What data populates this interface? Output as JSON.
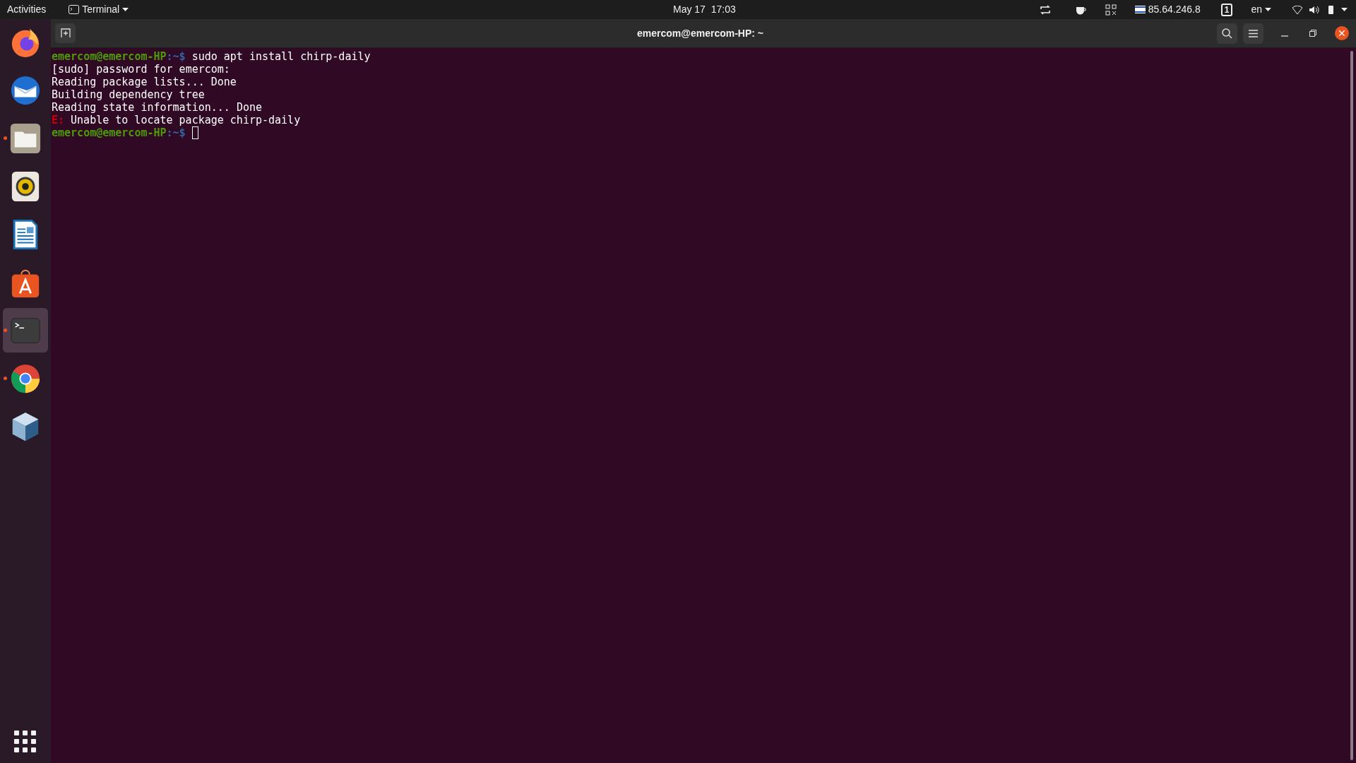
{
  "top_bar": {
    "activities": "Activities",
    "app_menu": "Terminal",
    "clock": "May 17  17:03",
    "ip": "85.64.246.8",
    "workspace": "1",
    "language": "en"
  },
  "dock": {
    "items": [
      {
        "kind": "firefox",
        "running": false,
        "selected": false
      },
      {
        "kind": "mail",
        "running": false,
        "selected": false
      },
      {
        "kind": "files",
        "running": true,
        "selected": false
      },
      {
        "kind": "speaker",
        "running": false,
        "selected": false
      },
      {
        "kind": "writer",
        "running": false,
        "selected": false
      },
      {
        "kind": "store",
        "running": false,
        "selected": false
      },
      {
        "kind": "terminal",
        "running": true,
        "selected": true
      },
      {
        "kind": "chrome",
        "running": true,
        "selected": false
      },
      {
        "kind": "cube",
        "running": false,
        "selected": false
      }
    ]
  },
  "window": {
    "title": "emercom@emercom-HP: ~"
  },
  "terminal": {
    "lines": [
      {
        "kind": "prompt",
        "user": "emercom@emercom-HP",
        "path": ":~$",
        "text": "sudo apt install chirp-daily"
      },
      {
        "kind": "output",
        "text": "[sudo] password for emercom:"
      },
      {
        "kind": "output",
        "text": "Reading package lists... Done"
      },
      {
        "kind": "output",
        "text": "Building dependency tree"
      },
      {
        "kind": "output",
        "text": "Reading state information... Done"
      },
      {
        "kind": "error",
        "tag": "E:",
        "text": "Unable to locate package chirp-daily"
      },
      {
        "kind": "prompt",
        "user": "emercom@emercom-HP",
        "path": ":~$",
        "cursor": true
      }
    ]
  }
}
